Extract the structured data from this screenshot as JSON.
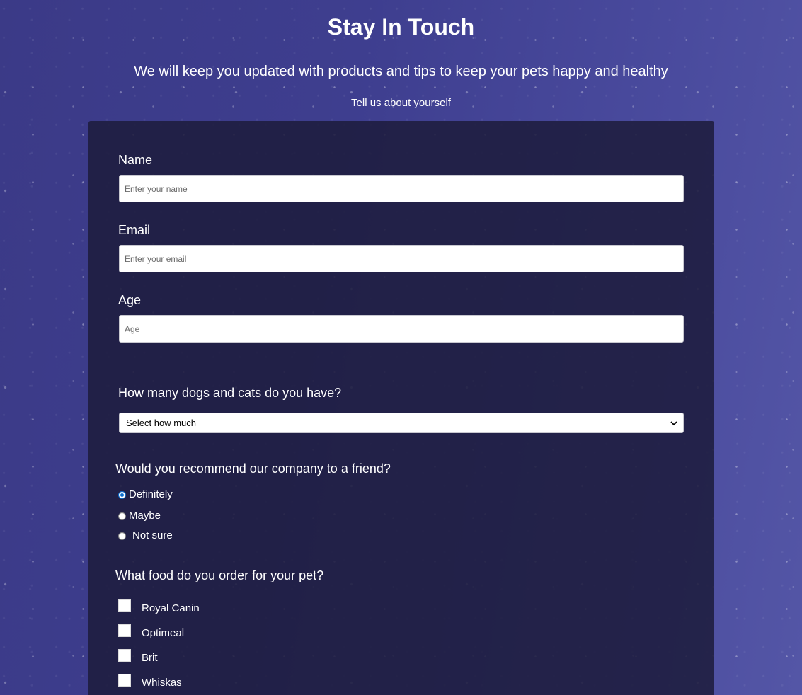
{
  "header": {
    "title": "Stay In Touch",
    "subtitle": "We will keep you updated with products and tips to keep your pets happy and healthy",
    "intro": "Tell us about yourself"
  },
  "form": {
    "name": {
      "label": "Name",
      "placeholder": "Enter your name",
      "value": ""
    },
    "email": {
      "label": "Email",
      "placeholder": "Enter your email",
      "value": ""
    },
    "age": {
      "label": "Age",
      "placeholder": "Age",
      "value": ""
    },
    "pets_count": {
      "label": "How many dogs and cats do you have?",
      "selected": "Select how much"
    },
    "recommend": {
      "label": "Would you recommend our company to a friend?",
      "options": [
        {
          "label": "Definitely",
          "checked": true
        },
        {
          "label": "Maybe",
          "checked": false
        },
        {
          "label": "Not sure",
          "checked": false
        }
      ]
    },
    "food": {
      "label": "What food do you order for your pet?",
      "options": [
        {
          "label": "Royal Canin",
          "checked": false
        },
        {
          "label": "Optimeal",
          "checked": false
        },
        {
          "label": "Brit",
          "checked": false
        },
        {
          "label": "Whiskas",
          "checked": false
        }
      ]
    }
  },
  "colors": {
    "background": "#3e3e8f",
    "card": "#1e1d3e",
    "radio_accent": "#0a6ed1"
  }
}
